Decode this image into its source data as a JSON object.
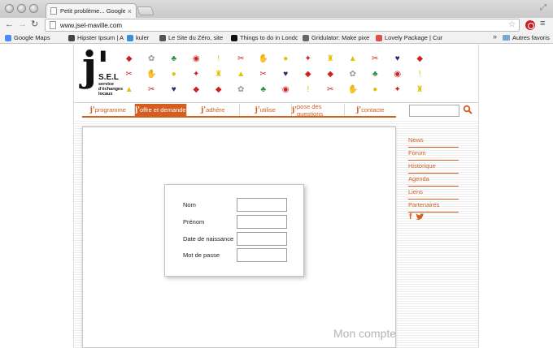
{
  "browser": {
    "tab_title": "Petit problème... Google Chr",
    "url": "www.jsel-maville.com",
    "bookmarks": [
      {
        "label": "Google Maps",
        "color": "#4c8bf5"
      },
      {
        "label": "Hipster Ipsum | Artisa",
        "color": "#444444"
      },
      {
        "label": "kuler",
        "color": "#3b8ed6"
      },
      {
        "label": "Le Site du Zéro, site",
        "color": "#555555"
      },
      {
        "label": "Things to do in Londo",
        "color": "#111111"
      },
      {
        "label": "Gridulator: Make pixe",
        "color": "#666666"
      },
      {
        "label": "Lovely Package | Cura",
        "color": "#e0504a"
      }
    ],
    "bookmarks_more": "»",
    "other_bookmarks": "Autres favoris"
  },
  "site": {
    "logo_j": "j'",
    "logo_sel": "S.E.L",
    "logo_tagline": "service d'échanges locaux",
    "nav": [
      {
        "j": "j'",
        "label": "programme",
        "active": false
      },
      {
        "j": "j'",
        "label": "offre et demande",
        "active": true
      },
      {
        "j": "j'",
        "label": "adhère",
        "active": false
      },
      {
        "j": "j'",
        "label": "utilise",
        "active": false
      },
      {
        "j": "j'",
        "label": "pose des questions",
        "active": false
      },
      {
        "j": "j'",
        "label": "contacte",
        "active": false
      }
    ],
    "search_value": "",
    "side_links": [
      "News",
      "Forum",
      "Historique",
      "Agenda",
      "Liens",
      "Partenaires"
    ],
    "form": {
      "fields": [
        {
          "label": "Nom",
          "value": ""
        },
        {
          "label": "Prénom",
          "value": ""
        },
        {
          "label": "Date de naissance",
          "value": ""
        },
        {
          "label": "Mot de passe",
          "value": ""
        }
      ]
    },
    "footer_label": "Mon compte",
    "colors": {
      "accent": "#d25e20",
      "muted_text": "#b4b4b4"
    }
  }
}
